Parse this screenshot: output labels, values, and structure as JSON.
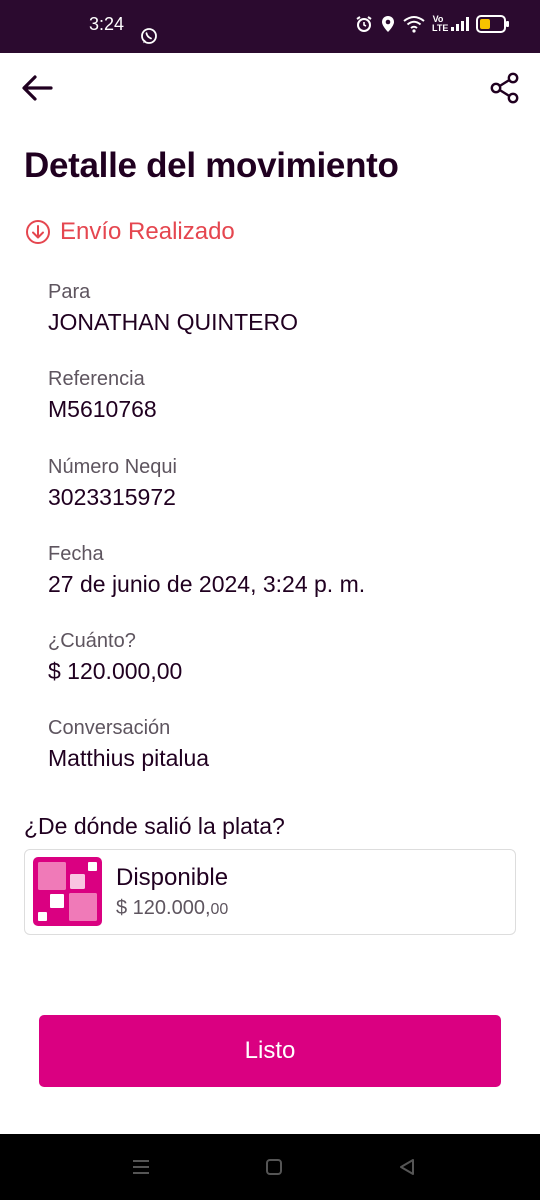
{
  "status_bar": {
    "time": "3:24",
    "network_label": "Vo LTE",
    "icons": [
      "whatsapp-icon",
      "alarm-icon",
      "location-icon",
      "wifi-icon",
      "signal-icon",
      "battery-icon"
    ],
    "battery_color": "#f6c200"
  },
  "header": {
    "back_icon": "arrow-left-icon",
    "share_icon": "share-icon",
    "title": "Detalle del movimiento"
  },
  "transaction": {
    "status_text": "Envío Realizado",
    "status_icon": "arrow-down-circle-icon",
    "status_color": "#e5464f",
    "details": [
      {
        "label": "Para",
        "value": "JONATHAN QUINTERO"
      },
      {
        "label": "Referencia",
        "value": "M5610768"
      },
      {
        "label": "Número Nequi",
        "value": "3023315972"
      },
      {
        "label": "Fecha",
        "value": "27 de junio de 2024, 3:24 p. m."
      },
      {
        "label": "¿Cuánto?",
        "value": "$ 120.000,00"
      },
      {
        "label": "Conversación",
        "value": "Matthius pitalua"
      }
    ]
  },
  "source": {
    "heading": "¿De dónde salió la plata?",
    "name": "Disponible",
    "amount_main": "$ 120.000,",
    "amount_decimals": "00",
    "icon": "nequi-pocket-icon"
  },
  "actions": {
    "done_label": "Listo",
    "accent_color": "#da0081"
  },
  "system_nav": {
    "icons": [
      "menu-icon",
      "home-icon",
      "back-triangle-icon"
    ]
  }
}
